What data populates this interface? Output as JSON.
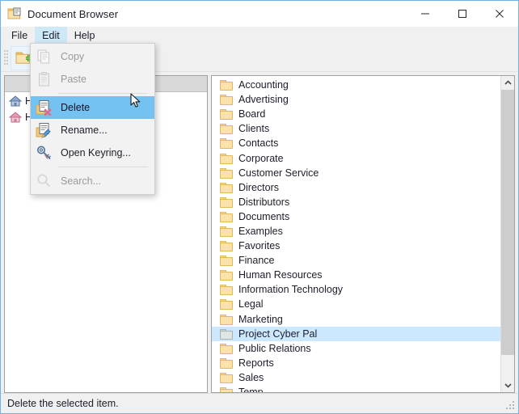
{
  "window": {
    "title": "Document Browser",
    "icon": "document-folder-icon",
    "controls": {
      "minimize": "─",
      "maximize": "□",
      "close": "✕"
    },
    "border_color": "#6fb3e8"
  },
  "menubar": {
    "items": [
      {
        "label": "File",
        "open": false
      },
      {
        "label": "Edit",
        "open": true
      },
      {
        "label": "Help",
        "open": false
      }
    ]
  },
  "toolbar": {
    "buttons": [
      {
        "name": "new-folder-button",
        "icon": "folder-add-icon",
        "active": true
      },
      {
        "name": "open-folder-button",
        "icon": "folder-open-icon",
        "active": false
      },
      {
        "name": "edit-document-button",
        "icon": "document-edit-icon",
        "active": false
      },
      {
        "name": "open-keyring-button",
        "icon": "keyring-icon",
        "active": false
      },
      {
        "name": "search-button",
        "icon": "magnifier-icon",
        "active": false
      }
    ]
  },
  "edit_menu": {
    "items": [
      {
        "label": "Copy",
        "icon": "copy-icon",
        "enabled": false,
        "highlighted": false,
        "separator_after": false
      },
      {
        "label": "Paste",
        "icon": "paste-icon",
        "enabled": false,
        "highlighted": false,
        "separator_after": true
      },
      {
        "label": "Delete",
        "icon": "document-delete-icon",
        "enabled": true,
        "highlighted": true,
        "separator_after": false
      },
      {
        "label": "Rename...",
        "icon": "document-edit-icon",
        "enabled": true,
        "highlighted": false,
        "separator_after": false
      },
      {
        "label": "Open Keyring...",
        "icon": "keyring-icon",
        "enabled": true,
        "highlighted": false,
        "separator_after": true
      },
      {
        "label": "Search...",
        "icon": "magnifier-icon",
        "enabled": false,
        "highlighted": false,
        "separator_after": false
      }
    ],
    "highlight_color": "#74c2f2"
  },
  "tree_panel": {
    "items": [
      {
        "label": "H",
        "icon": "home-blue-icon"
      },
      {
        "label": "H",
        "icon": "home-pink-icon"
      }
    ]
  },
  "file_list": {
    "selected": "Project Cyber Pal",
    "selection_color": "#cce8ff",
    "items": [
      {
        "label": "Accounting"
      },
      {
        "label": "Advertising"
      },
      {
        "label": "Board"
      },
      {
        "label": "Clients"
      },
      {
        "label": "Contacts"
      },
      {
        "label": "Corporate"
      },
      {
        "label": "Customer Service"
      },
      {
        "label": "Directors"
      },
      {
        "label": "Distributors"
      },
      {
        "label": "Documents"
      },
      {
        "label": "Examples"
      },
      {
        "label": "Favorites"
      },
      {
        "label": "Finance"
      },
      {
        "label": "Human Resources"
      },
      {
        "label": "Information Technology"
      },
      {
        "label": "Legal"
      },
      {
        "label": "Marketing"
      },
      {
        "label": "Project Cyber Pal"
      },
      {
        "label": "Public Relations"
      },
      {
        "label": "Reports"
      },
      {
        "label": "Sales"
      },
      {
        "label": "Temp"
      }
    ]
  },
  "scrollbar": {
    "up_arrow": "⌃",
    "down_arrow": "⌄"
  },
  "statusbar": {
    "text": "Delete the selected item."
  }
}
